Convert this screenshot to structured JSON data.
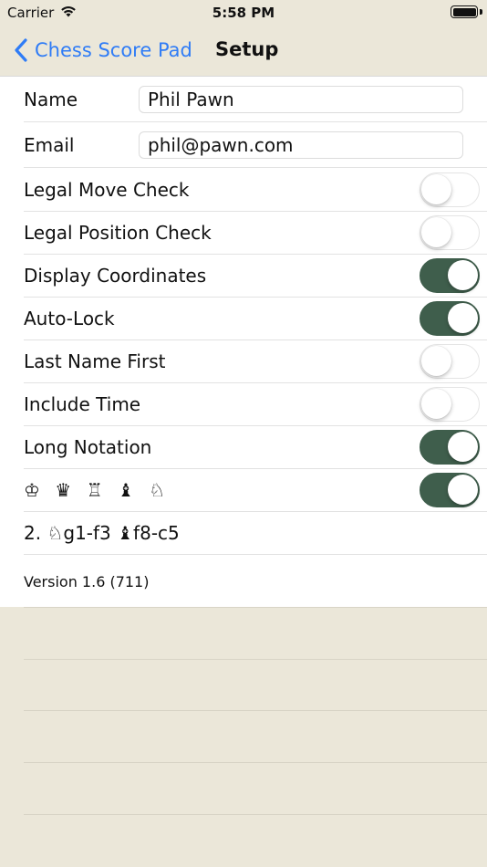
{
  "status_bar": {
    "carrier": "Carrier",
    "time": "5:58 PM"
  },
  "nav": {
    "back_label": "Chess Score Pad",
    "title": "Setup"
  },
  "fields": {
    "name_label": "Name",
    "name_value": "Phil Pawn",
    "email_label": "Email",
    "email_value": "phil@pawn.com"
  },
  "toggles": [
    {
      "label": "Legal Move Check",
      "on": false
    },
    {
      "label": "Legal Position Check",
      "on": false
    },
    {
      "label": "Display Coordinates",
      "on": true
    },
    {
      "label": "Auto-Lock",
      "on": true
    },
    {
      "label": "Last Name First",
      "on": false
    },
    {
      "label": "Include Time",
      "on": false
    },
    {
      "label": "Long Notation",
      "on": true
    },
    {
      "label": "♔ ♛ ♖ ♝ ♘",
      "on": true
    }
  ],
  "notation_example": "2. ♘g1-f3 ♝f8-c5",
  "version": "Version 1.6 (711)",
  "colors": {
    "accent": "#2f7cf6",
    "toggle_on": "#3f5e4c",
    "background": "#ebe7d9"
  }
}
